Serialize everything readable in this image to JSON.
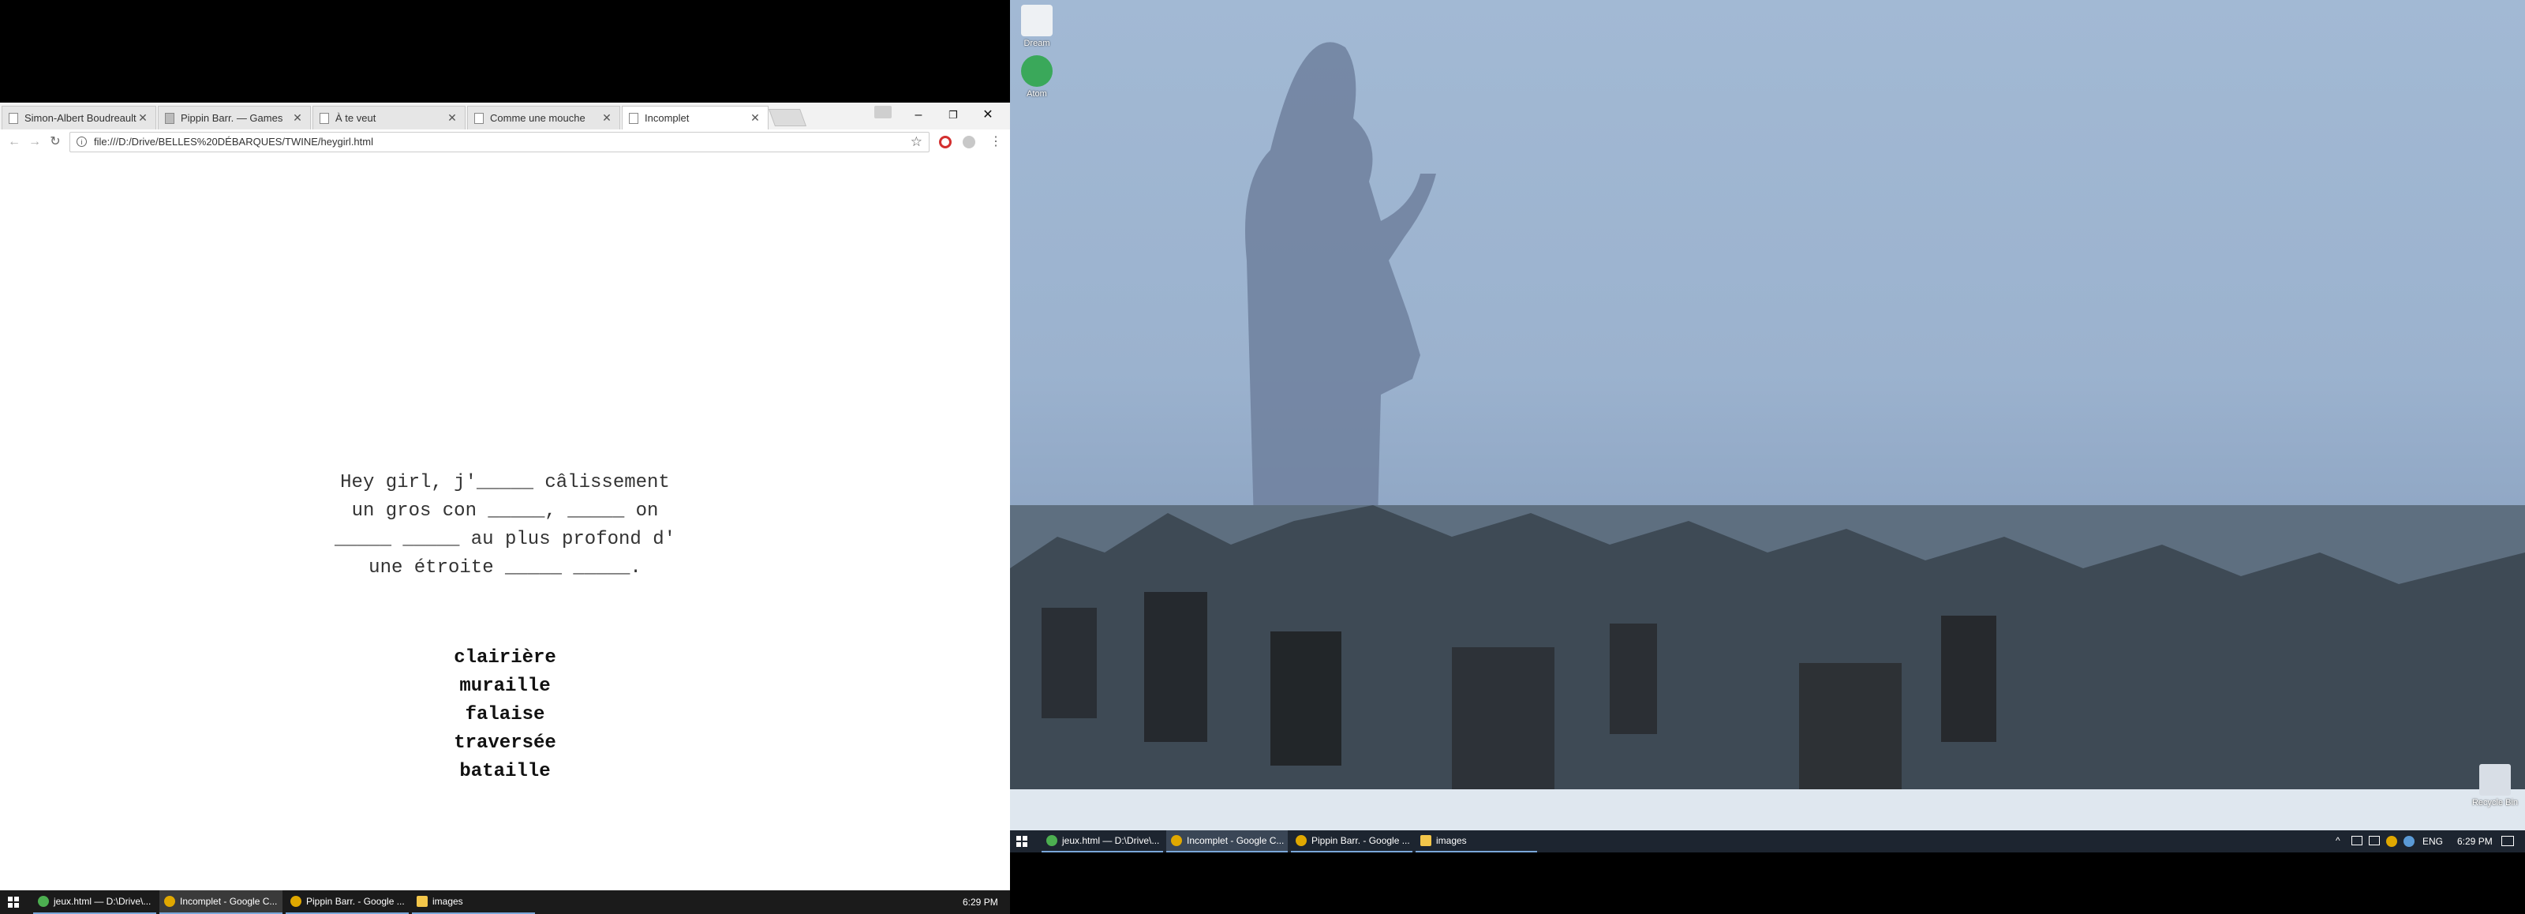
{
  "browser": {
    "tabs": [
      {
        "label": "Simon-Albert Boudreault"
      },
      {
        "label": "Pippin Barr. — Games"
      },
      {
        "label": "À te veut"
      },
      {
        "label": "Comme une mouche"
      },
      {
        "label": "Incomplet"
      }
    ],
    "window_controls": {
      "minimize": "–",
      "restore": "❐",
      "close": "✕"
    },
    "address_bar": {
      "url": "file:///D:/Drive/BELLES%20DÉBARQUES/TWINE/heygirl.html"
    },
    "nav": {
      "back": "←",
      "forward": "→",
      "reload": "↻",
      "star": "☆",
      "menu": "⋮"
    }
  },
  "page": {
    "poem_lines": [
      "Hey girl, j'_____ câlissement",
      "un gros con _____, _____ on",
      "_____ _____ au plus profond d'",
      "une étroite _____ _____."
    ],
    "choices": [
      "clairière",
      "muraille",
      "falaise",
      "traversée",
      "bataille"
    ]
  },
  "left_taskbar": {
    "items": [
      {
        "label": "jeux.html — D:\\Drive\\..."
      },
      {
        "label": "Incomplet - Google C..."
      },
      {
        "label": "Pippin Barr. - Google ..."
      },
      {
        "label": "images"
      }
    ],
    "clock": "6:29 PM"
  },
  "right_desktop": {
    "icons": [
      {
        "label": "Dream"
      },
      {
        "label": "Atom"
      },
      {
        "label": "Recycle Bin"
      }
    ]
  },
  "right_taskbar": {
    "items": [
      {
        "label": "jeux.html — D:\\Drive\\..."
      },
      {
        "label": "Incomplet - Google C..."
      },
      {
        "label": "Pippin Barr. - Google ..."
      },
      {
        "label": "images"
      }
    ],
    "language": "ENG",
    "clock": "6:29 PM"
  }
}
